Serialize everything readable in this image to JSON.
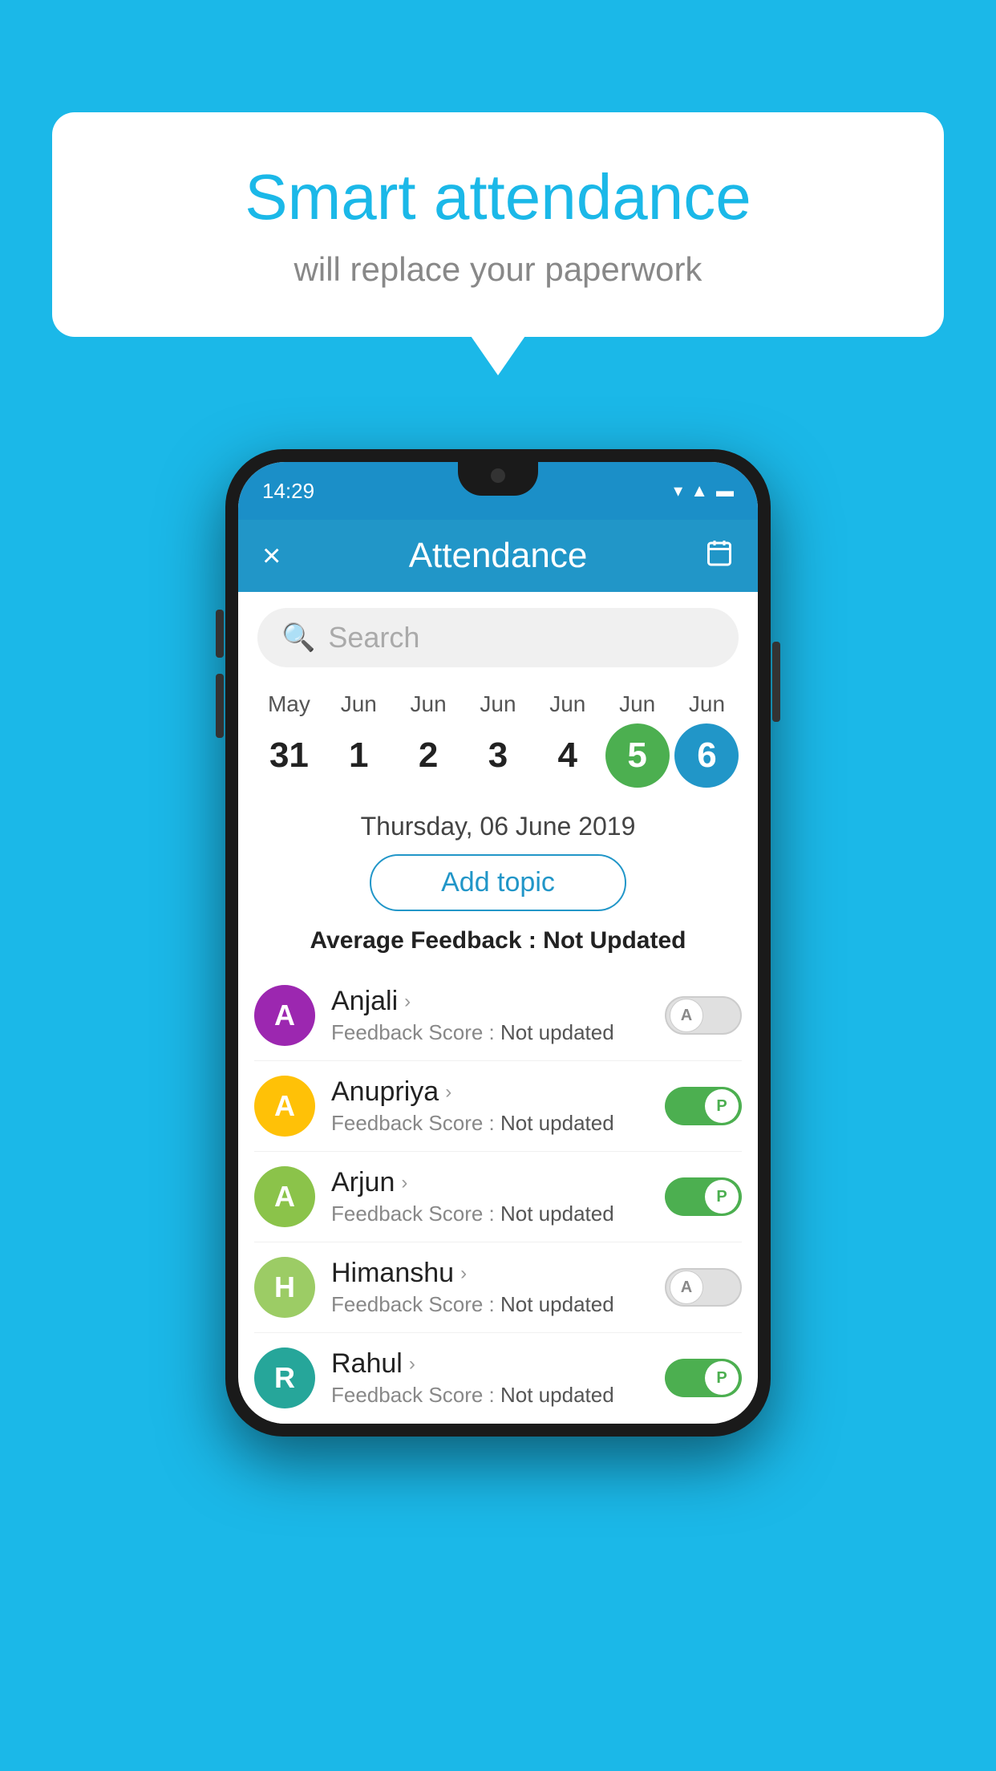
{
  "background": {
    "color": "#1BB8E8"
  },
  "speech_bubble": {
    "title": "Smart attendance",
    "subtitle": "will replace your paperwork"
  },
  "phone": {
    "status_bar": {
      "time": "14:29",
      "icons": [
        "wifi",
        "signal",
        "battery"
      ]
    },
    "app_bar": {
      "close_label": "×",
      "title": "Attendance",
      "calendar_icon": "📅"
    },
    "search": {
      "placeholder": "Search"
    },
    "calendar": {
      "days": [
        {
          "month": "May",
          "date": "31"
        },
        {
          "month": "Jun",
          "date": "1"
        },
        {
          "month": "Jun",
          "date": "2"
        },
        {
          "month": "Jun",
          "date": "3"
        },
        {
          "month": "Jun",
          "date": "4"
        },
        {
          "month": "Jun",
          "date": "5",
          "state": "today"
        },
        {
          "month": "Jun",
          "date": "6",
          "state": "selected"
        }
      ]
    },
    "selected_date": "Thursday, 06 June 2019",
    "add_topic_label": "Add topic",
    "avg_feedback_label": "Average Feedback : ",
    "avg_feedback_value": "Not Updated",
    "students": [
      {
        "name": "Anjali",
        "initial": "A",
        "avatar_color": "#9C27B0",
        "feedback_label": "Feedback Score : ",
        "feedback_value": "Not updated",
        "toggle_state": "off",
        "toggle_letter": "A"
      },
      {
        "name": "Anupriya",
        "initial": "A",
        "avatar_color": "#FFC107",
        "feedback_label": "Feedback Score : ",
        "feedback_value": "Not updated",
        "toggle_state": "on",
        "toggle_letter": "P"
      },
      {
        "name": "Arjun",
        "initial": "A",
        "avatar_color": "#8BC34A",
        "feedback_label": "Feedback Score : ",
        "feedback_value": "Not updated",
        "toggle_state": "on",
        "toggle_letter": "P"
      },
      {
        "name": "Himanshu",
        "initial": "H",
        "avatar_color": "#9CCC65",
        "feedback_label": "Feedback Score : ",
        "feedback_value": "Not updated",
        "toggle_state": "off",
        "toggle_letter": "A"
      },
      {
        "name": "Rahul",
        "initial": "R",
        "avatar_color": "#26A69A",
        "feedback_label": "Feedback Score : ",
        "feedback_value": "Not updated",
        "toggle_state": "on",
        "toggle_letter": "P"
      }
    ]
  }
}
